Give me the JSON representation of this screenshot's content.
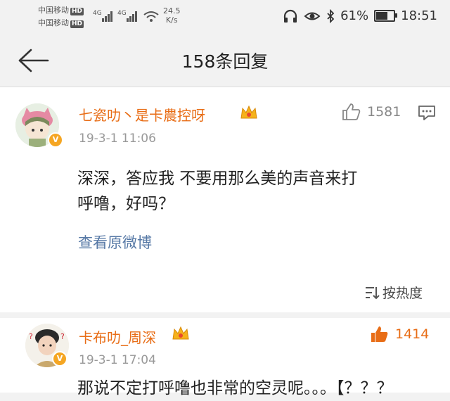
{
  "status_bar": {
    "carrier1": "中国移动",
    "carrier2": "中国移动",
    "hd_label": "HD",
    "net_type1": "4G",
    "net_type2": "4G",
    "net_speed_value": "24.5",
    "net_speed_unit": "K/s",
    "battery_percent": "61%",
    "battery_level": 0.61,
    "time": "18:51"
  },
  "nav": {
    "title": "158条回复"
  },
  "comments": [
    {
      "username": "七瓷叻丶是卡農控呀",
      "timestamp": "19-3-1 11:06",
      "likes": "1581",
      "liked": false,
      "text_line1": "深深，答应我 不要用那么美的声音来打",
      "text_line2": "呼噜，好吗？",
      "view_original": "查看原微博",
      "sort_label": "按热度"
    },
    {
      "username": "卡布叻_周深",
      "timestamp": "19-3-1 17:04",
      "likes": "1414",
      "liked": true,
      "text_partial": "那说不定打呼噜也非常的空灵呢。。。【？？？"
    }
  ],
  "colors": {
    "username": "#e86d16",
    "link": "#5779a6",
    "like_active": "#e86d16",
    "meta": "#999999"
  },
  "icons": [
    "back-arrow-icon",
    "signal-icon",
    "wifi-icon",
    "headphones-icon",
    "eye-icon",
    "bluetooth-icon",
    "battery-icon",
    "crown-icon",
    "verified-icon",
    "thumbs-up-icon",
    "reply-icon",
    "sort-icon"
  ]
}
